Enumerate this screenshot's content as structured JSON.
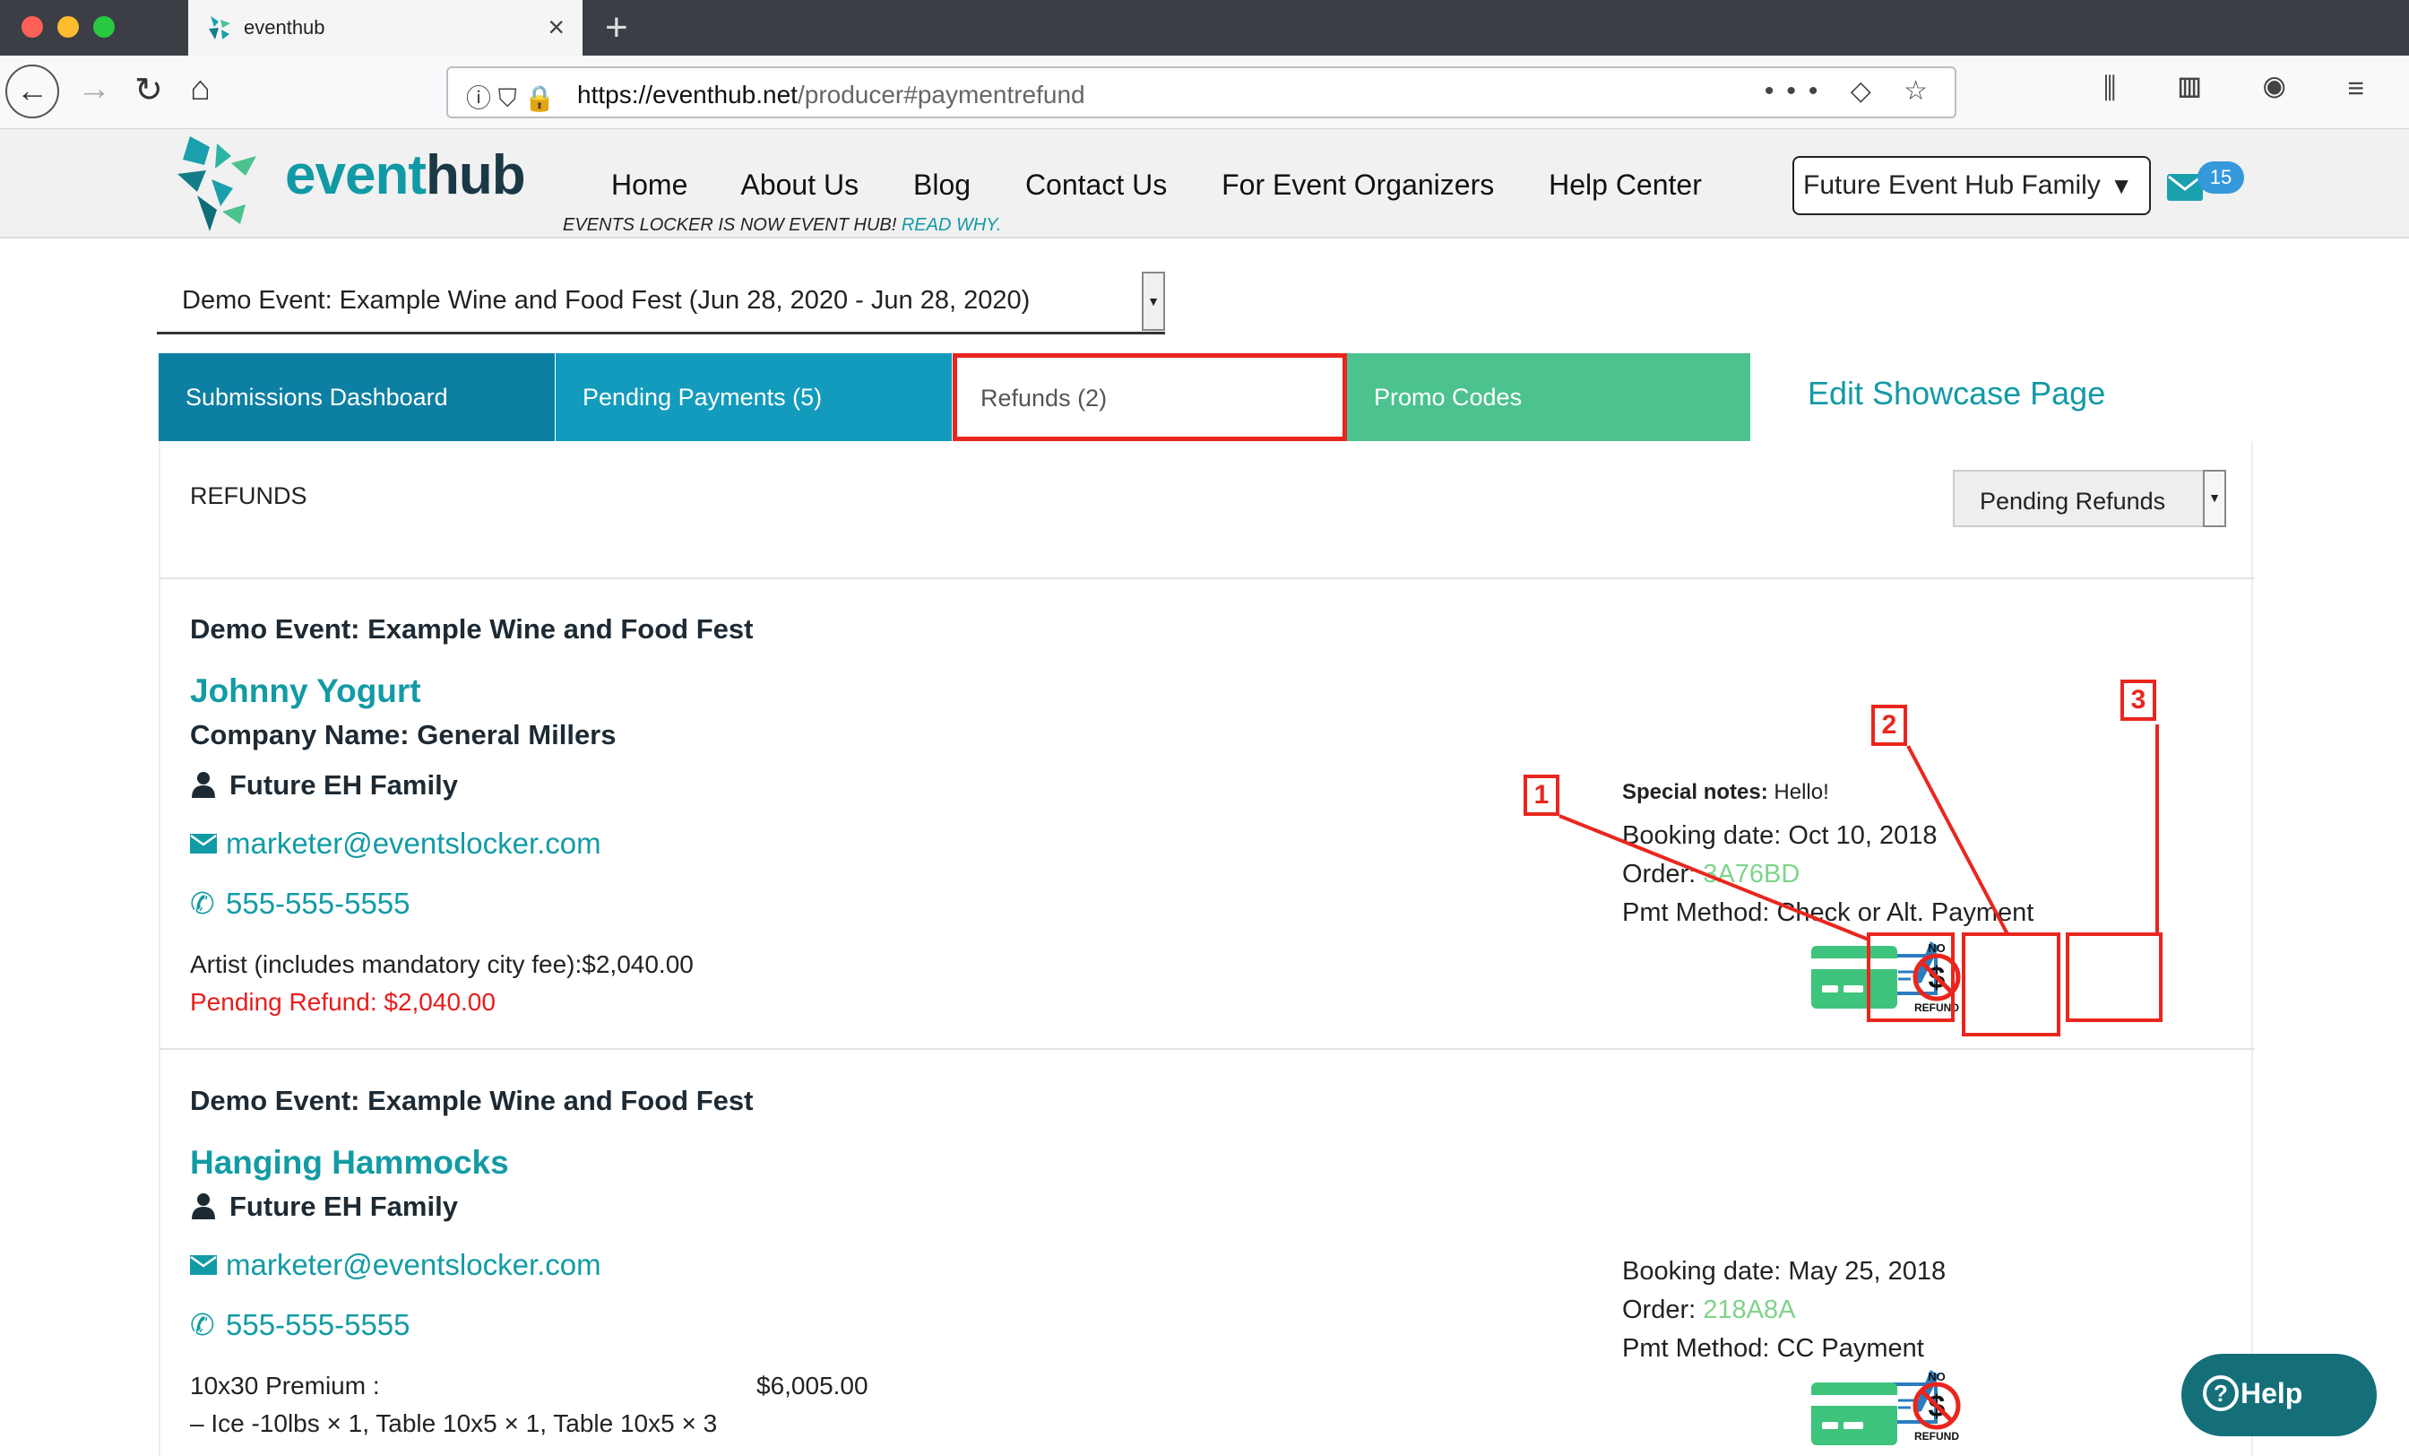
{
  "browser": {
    "tab_title": "eventhub",
    "url_domain": "https://eventhub.net",
    "url_path": "/producer#paymentrefund",
    "colors": {
      "chrome": "#3b3f45"
    }
  },
  "header": {
    "logo_event": "event",
    "logo_hub": "hub",
    "menu": [
      "Home",
      "About Us",
      "Blog",
      "Contact Us",
      "For Event Organizers",
      "Help Center"
    ],
    "tagline": "EVENTS LOCKER IS NOW EVENT HUB!",
    "tagline_link": "READ WHY.",
    "family_select": "Future Event Hub Family",
    "mail_badge": "15"
  },
  "event_select": "Demo Event: Example Wine and Food Fest (Jun 28, 2020 - Jun 28, 2020)",
  "tabs": {
    "submissions": "Submissions Dashboard",
    "pending": "Pending Payments (5)",
    "refunds": "Refunds (2)",
    "promo": "Promo Codes",
    "showcase": "Edit Showcase Page"
  },
  "panel": {
    "title": "REFUNDS",
    "filter": "Pending Refunds"
  },
  "records": [
    {
      "event": "Demo Event: Example Wine and Food Fest",
      "name": "Johnny Yogurt",
      "company": "Company Name: General Millers",
      "group": "Future EH Family",
      "email": "marketer@eventslocker.com",
      "phone": "555-555-5555",
      "item": "Artist (includes mandatory city fee):$2,040.00",
      "pending": "Pending Refund: $2,040.00",
      "notes_label": "Special notes:",
      "notes": "Hello!",
      "booking": "Booking date: Oct 10, 2018",
      "order_label": "Order:",
      "order": "3A76BD",
      "pmt": "Pmt Method: Check or Alt. Payment"
    },
    {
      "event": "Demo Event: Example Wine and Food Fest",
      "name": "Hanging Hammocks",
      "group": "Future EH Family",
      "email": "marketer@eventslocker.com",
      "phone": "555-555-5555",
      "item_label": "10x30 Premium :",
      "item_price": "$6,005.00",
      "item_detail": "– Ice -10lbs × 1, Table 10x5 × 1, Table 10x5 × 3",
      "booking": "Booking date: May 25, 2018",
      "order_label": "Order:",
      "order": "218A8A",
      "pmt": "Pmt Method: CC Payment"
    }
  ],
  "icons": {
    "norefund_top": "NO",
    "norefund_bottom": "REFUND",
    "norefund_sign": "$"
  },
  "markers": [
    "1",
    "2",
    "3"
  ],
  "help": "Help"
}
